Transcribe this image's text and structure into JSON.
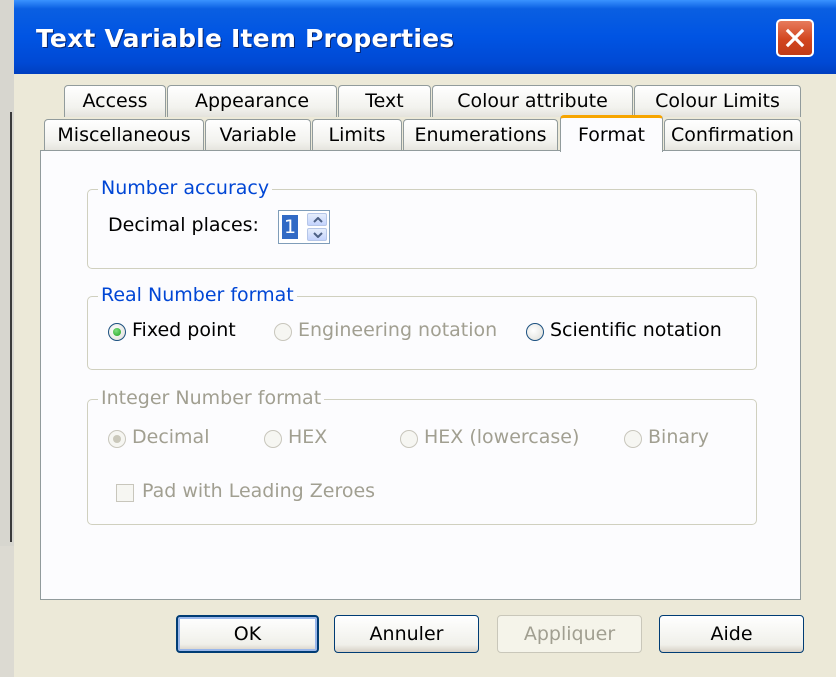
{
  "window": {
    "title": "Text Variable Item Properties"
  },
  "tabs": {
    "row1": [
      "Access",
      "Appearance",
      "Text",
      "Colour attribute",
      "Colour Limits"
    ],
    "row2": [
      "Miscellaneous",
      "Variable",
      "Limits",
      "Enumerations",
      "Format",
      "Confirmation"
    ],
    "active": "Format"
  },
  "number_accuracy": {
    "title": "Number accuracy",
    "decimal_label": "Decimal places:",
    "decimal_value": "1"
  },
  "real_format": {
    "title": "Real Number format",
    "options": [
      "Fixed point",
      "Engineering notation",
      "Scientific notation"
    ],
    "selected": "Fixed point",
    "disabled": [
      "Engineering notation"
    ]
  },
  "integer_format": {
    "title": "Integer Number format",
    "options": [
      "Decimal",
      "HEX",
      "HEX (lowercase)",
      "Binary"
    ],
    "selected": "Decimal",
    "enabled": false,
    "pad_label": "Pad with Leading Zeroes",
    "pad_checked": false
  },
  "buttons": {
    "ok": "OK",
    "cancel": "Annuler",
    "apply": "Appliquer",
    "help": "Aide"
  },
  "colors": {
    "titlebar": "#0054e3",
    "group_label": "#0046d5",
    "active_tab_accent": "#f7a500",
    "close_button": "#d2461f"
  },
  "icons": {
    "close": "close-x-icon",
    "spin_up": "chevron-up-icon",
    "spin_down": "chevron-down-icon"
  }
}
